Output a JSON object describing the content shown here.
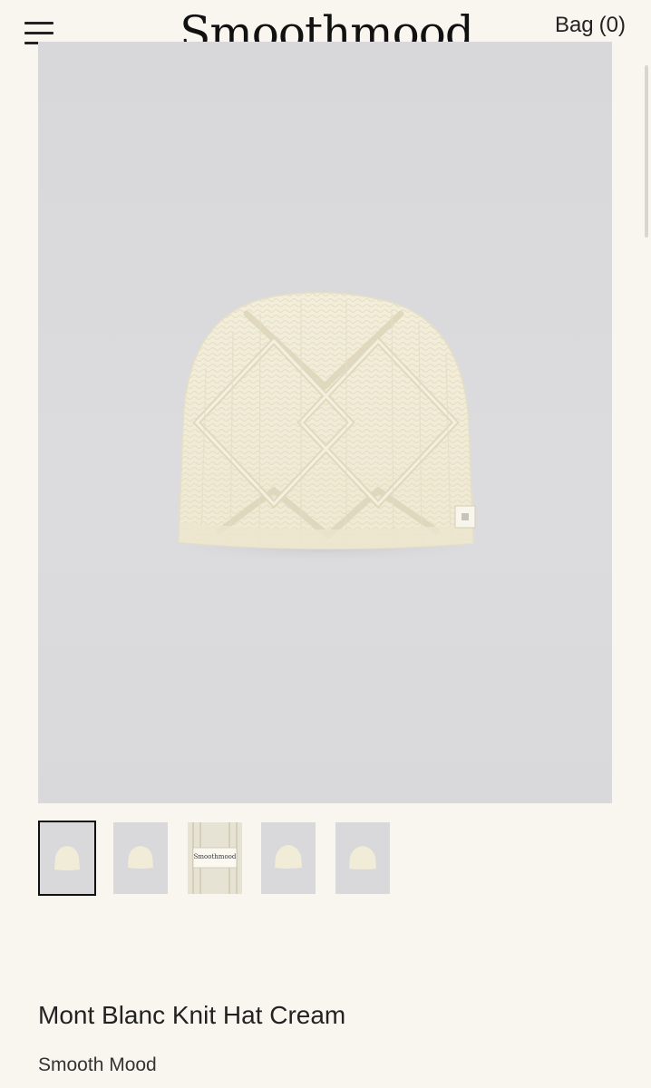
{
  "header": {
    "menu_icon": "hamburger-menu-icon",
    "logo_text": "Smoothmood",
    "bag_label": "Bag",
    "bag_count": "(0)"
  },
  "gallery": {
    "main_image_alt": "cream cable knit beanie",
    "thumbnails": [
      {
        "name": "thumbnail-1",
        "active": true
      },
      {
        "name": "thumbnail-2",
        "active": false
      },
      {
        "name": "thumbnail-3",
        "active": false,
        "label_text": "Smoothmood"
      },
      {
        "name": "thumbnail-4",
        "active": false
      },
      {
        "name": "thumbnail-5",
        "active": false
      }
    ]
  },
  "product": {
    "title": "Mont Blanc Knit Hat Cream",
    "brand": "Smooth Mood"
  },
  "colors": {
    "background": "#f9f6ef",
    "image_bg": "#d9d9db",
    "hat": "#f4efdc"
  }
}
